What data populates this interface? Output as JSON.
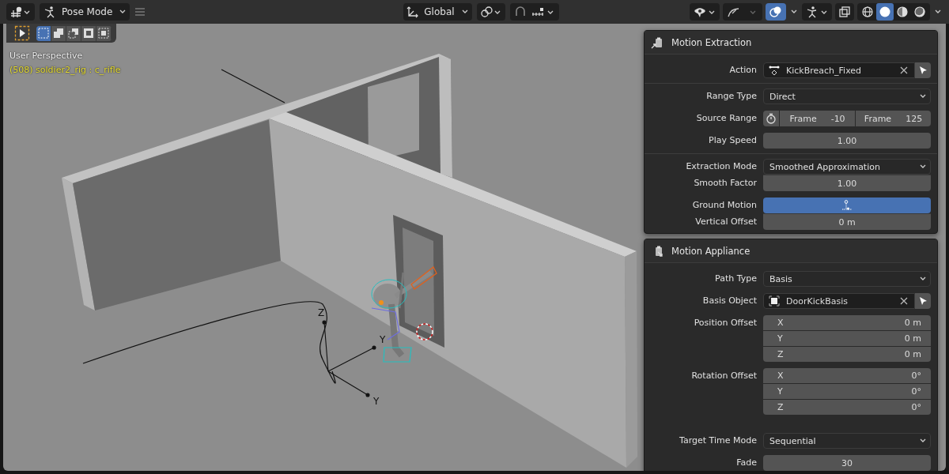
{
  "header": {
    "mode": "Pose Mode",
    "orientation": "Global",
    "overlays_on": true,
    "shading": [
      {
        "kind": "wireframe",
        "selected": false
      },
      {
        "kind": "solid",
        "selected": true
      },
      {
        "kind": "material",
        "selected": false
      },
      {
        "kind": "rendered",
        "selected": false
      }
    ]
  },
  "tool_header": {
    "select_modes": [
      {
        "kind": "set",
        "selected": true
      },
      {
        "kind": "extend",
        "selected": false
      },
      {
        "kind": "subtract",
        "selected": false
      },
      {
        "kind": "invert",
        "selected": false
      },
      {
        "kind": "intersect",
        "selected": false
      }
    ]
  },
  "viewport": {
    "view_name": "User Perspective",
    "object_info": "(508) soldier2_rig : c_rifle",
    "axis_labels": [
      "Z",
      "Y",
      "Y"
    ]
  },
  "panels": [
    {
      "title": "Motion Extraction",
      "kind": "extraction",
      "rows": [
        {
          "kind": "action",
          "label": "Action",
          "value": "KickBreach_Fixed"
        },
        {
          "kind": "dropdown",
          "label": "Range Type",
          "value": "Direct",
          "divider": true
        },
        {
          "kind": "range",
          "label": "Source Range",
          "fields": [
            {
              "label": "Frame",
              "value": "-10"
            },
            {
              "label": "Frame",
              "value": "125"
            }
          ]
        },
        {
          "kind": "number",
          "label": "Play Speed",
          "value": "1.00"
        },
        {
          "kind": "dropdown",
          "label": "Extraction Mode",
          "value": "Smoothed Approximation",
          "divider": true
        },
        {
          "kind": "number",
          "label": "Smooth Factor",
          "value": "1.00",
          "joined": true
        },
        {
          "kind": "toggle",
          "label": "Ground Motion",
          "on": true
        },
        {
          "kind": "number",
          "label": "Vertical Offset",
          "value": "0 m",
          "joined": true
        }
      ]
    },
    {
      "title": "Motion Appliance",
      "kind": "appliance",
      "rows": [
        {
          "kind": "dropdown",
          "label": "Path Type",
          "value": "Basis"
        },
        {
          "kind": "object",
          "label": "Basis Object",
          "value": "DoorKickBasis"
        },
        {
          "kind": "vector",
          "label": "Position Offset",
          "fields": [
            {
              "label": "X",
              "value": "0 m"
            },
            {
              "label": "Y",
              "value": "0 m"
            },
            {
              "label": "Z",
              "value": "0 m"
            }
          ]
        },
        {
          "kind": "vector",
          "label": "Rotation Offset",
          "fields": [
            {
              "label": "X",
              "value": "0°"
            },
            {
              "label": "Y",
              "value": "0°"
            },
            {
              "label": "Z",
              "value": "0°"
            }
          ]
        },
        {
          "kind": "dropdown",
          "label": "Target Time Mode",
          "value": "Sequential"
        },
        {
          "kind": "number",
          "label": "Fade",
          "value": "30"
        }
      ]
    }
  ]
}
